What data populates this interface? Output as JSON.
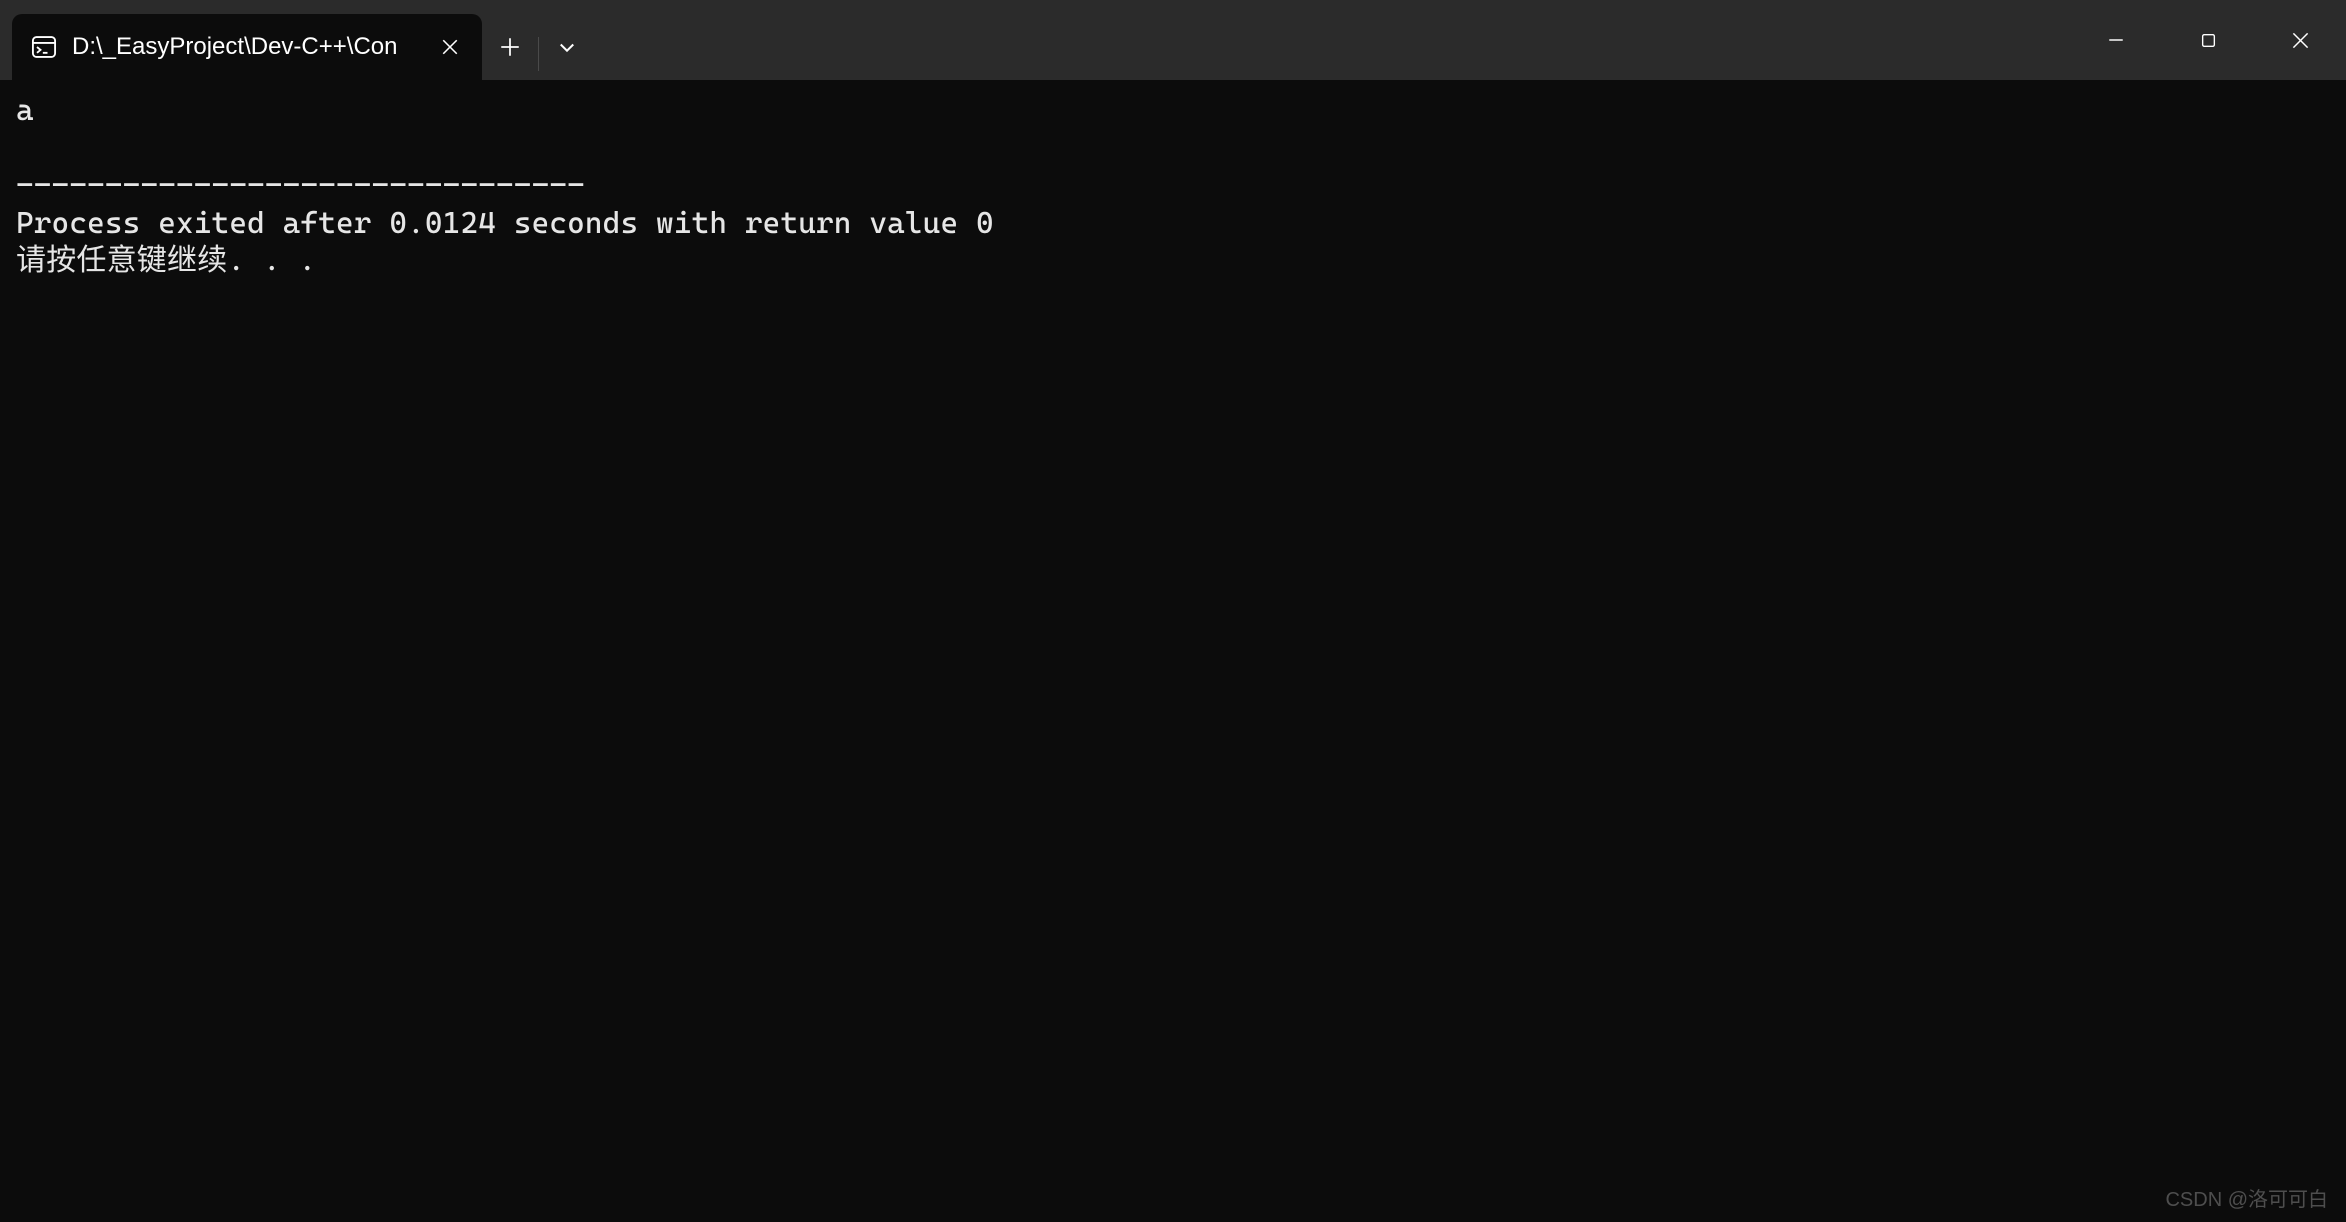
{
  "titlebar": {
    "tab": {
      "title": "D:\\_EasyProject\\Dev-C++\\Con"
    }
  },
  "terminal": {
    "line1": "a",
    "line2": "",
    "divider": "--------------------------------",
    "process_line": "Process exited after 0.0124 seconds with return value 0",
    "prompt_line": "请按任意键继续. . ."
  },
  "watermark": "CSDN @洛可可白"
}
